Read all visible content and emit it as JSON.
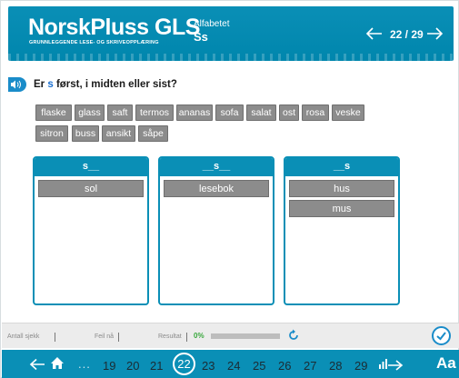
{
  "header": {
    "logo": "NorskPluss GLS",
    "logo_sub": "GRUNNLEGGENDE LESE- OG SKRIVEOPPLÆRING",
    "subtitle": "Alfabetet",
    "title": "Ss",
    "counter": "22 / 29"
  },
  "question": {
    "prefix": "Er ",
    "highlight": "s",
    "suffix": " først, i midten eller sist?"
  },
  "words": [
    "flaske",
    "glass",
    "saft",
    "termos",
    "ananas",
    "sofa",
    "salat",
    "ost",
    "rosa",
    "veske",
    "sitron",
    "buss",
    "ansikt",
    "såpe"
  ],
  "columns": [
    {
      "header": "s__",
      "items": [
        "sol"
      ]
    },
    {
      "header": "__s__",
      "items": [
        "lesebok"
      ]
    },
    {
      "header": "__s",
      "items": [
        "hus",
        "mus"
      ]
    }
  ],
  "status": {
    "attempts_label": "Antall sjekk",
    "errors_label": "Feil nå",
    "result_label": "Resultat",
    "result_value": "0%",
    "progress": 0
  },
  "pager": {
    "ellipsis": "...",
    "pages": [
      "19",
      "20",
      "21",
      "22",
      "23",
      "24",
      "25",
      "26",
      "27",
      "28",
      "29"
    ],
    "current": "22",
    "font_button": "Aa"
  },
  "colors": {
    "brand": "#0a8fb6",
    "chip": "#8c8c8c",
    "result_green": "#39a83d"
  }
}
